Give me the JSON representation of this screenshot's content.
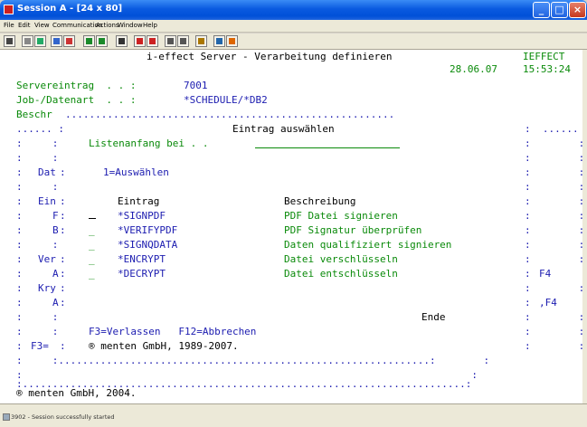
{
  "window": {
    "title": "Session A - [24 x 80]"
  },
  "menu": [
    "File",
    "Edit",
    "View",
    "Communication",
    "Actions",
    "Window",
    "Help"
  ],
  "toolbar_icons": [
    "print-screen-icon",
    "copy-icon",
    "paste-icon",
    "send-icon",
    "receive-icon",
    "display-icon",
    "keyboard-icon",
    "macro-record-icon",
    "macro-play-icon",
    "macro-stop-icon",
    "run-icon",
    "script-icon",
    "settings-icon",
    "help-icon",
    "color-icon"
  ],
  "screen": {
    "header_title": "i-effect Server - Verarbeitung definieren",
    "system_name": "IEFFECT",
    "date": "28.06.07",
    "time": "15:53:24",
    "server_label": "Servereintrag  . . :",
    "server_value": "7001",
    "job_label": "Job-/Datenart  . . :",
    "job_value": "*SCHEDULE/*DB2",
    "beschr_label": "Beschr",
    "dialog_title": "Eintrag auswählen",
    "list_start_label": "Listenanfang bei . .",
    "option_hint": "1=Auswählen",
    "col_entry": "Eintrag",
    "col_description": "Beschreibung",
    "entries": [
      {
        "entry": "*SIGNPDF",
        "description": "PDF Datei signieren"
      },
      {
        "entry": "*VERIFYPDF",
        "description": "PDF Signatur überprüfen"
      },
      {
        "entry": "*SIGNQDATA",
        "description": "Daten qualifiziert signieren"
      },
      {
        "entry": "*ENCRYPT",
        "description": "Datei verschlüsseln"
      },
      {
        "entry": "*DECRYPT",
        "description": "Datei entschlüsseln"
      }
    ],
    "end_label": "Ende",
    "fkeys": "F3=Verlassen   F12=Abbrechen",
    "dialog_copyright": "® menten GmbH, 1989-2007.",
    "bg_labels": {
      "dat": "Dat",
      "ein": "Ein",
      "f": "F",
      "b": "B",
      "ver": "Ver",
      "a1": "A",
      "kry": "Kry",
      "a2": "A",
      "f3": "F3=",
      "f4_1": "F4",
      "f4_2": ",F4"
    },
    "footer_copyright": "® menten GmbH, 2004."
  },
  "status": "3902 - Session successfully started"
}
